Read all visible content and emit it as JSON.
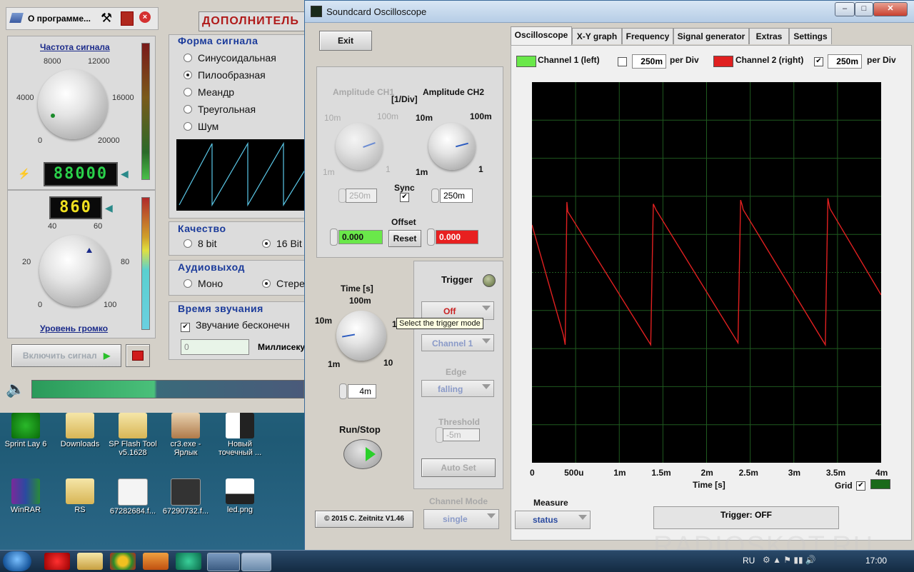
{
  "desktop": {
    "icons": [
      {
        "label": "Sprint Lay 6",
        "line2": ""
      },
      {
        "label": "Downloads",
        "line2": ""
      },
      {
        "label": "SP Flash Tool",
        "line2": "v5.1628"
      },
      {
        "label": "cr3.exe -",
        "line2": "Ярлык"
      },
      {
        "label": "Новый",
        "line2": "точечный ..."
      },
      {
        "label": "WinRAR",
        "line2": ""
      },
      {
        "label": "RS",
        "line2": ""
      },
      {
        "label": "67282684.f...",
        "line2": ""
      },
      {
        "label": "67290732.f...",
        "line2": ""
      },
      {
        "label": "led.png",
        "line2": ""
      }
    ]
  },
  "taskbar": {
    "lang": "RU",
    "clock": "17:00"
  },
  "generator": {
    "about_label": "О программе...",
    "freq_title": "Частота сигнала",
    "freq_scale": [
      "8000",
      "12000",
      "4000",
      "16000",
      "0",
      "20000"
    ],
    "freq_lcd": "88000",
    "level_lcd": "860",
    "level_scale": [
      "40",
      "60",
      "20",
      "80",
      "0",
      "100"
    ],
    "level_title": "Уровень громко",
    "start_label": "Включить сигнал",
    "header_title": "ДОПОЛНИТЕЛЬ",
    "waveform_title": "Форма сигнала",
    "waveforms": [
      "Синусоидальная",
      "Пилообразная",
      "Меандр",
      "Треугольная",
      "Шум"
    ],
    "quality_title": "Качество",
    "quality_opts": [
      "8 bit",
      "16 Bit"
    ],
    "output_title": "Аудиовыход",
    "output_opts": [
      "Моно",
      "Стере"
    ],
    "time_title": "Время звучания",
    "endless_label": "Звучание бесконечн",
    "duration_value": "0",
    "ms_label": "Миллисеку"
  },
  "osc": {
    "title": "Soundcard Oscilloscope",
    "exit_label": "Exit",
    "tabs": [
      "Oscilloscope",
      "X-Y graph",
      "Frequency",
      "Signal generator",
      "Extras",
      "Settings"
    ],
    "ch1_label": "Channel 1 (left)",
    "ch1_div": "250m",
    "per_div": "per Div",
    "ch2_label": "Channel 2 (right)",
    "ch2_div": "250m",
    "amp_ch1": "Amplitude CH1",
    "amp_unit": "[1/Div]",
    "amp_ch2": "Amplitude CH2",
    "amp_scale": [
      "10m",
      "100m",
      "1m",
      "1"
    ],
    "amp_ch1_value": "250m",
    "amp_ch2_value": "250m",
    "sync_label": "Sync",
    "offset_label": "Offset",
    "offset_ch1": "0.000",
    "offset_ch2": "0.000",
    "reset_label": "Reset",
    "time_label": "Time [s]",
    "time_scale": [
      "100m",
      "10m",
      "1",
      "1m",
      "10"
    ],
    "time_value": "4m",
    "runstop_label": "Run/Stop",
    "copyright": "© 2015  C. Zeitnitz V1.46",
    "trigger_title": "Trigger",
    "trigger_mode": "Off",
    "tooltip": "Select the trigger mode",
    "trigger_channel": "Channel 1",
    "edge_label": "Edge",
    "edge_value": "falling",
    "threshold_label": "Threshold",
    "threshold_value": "-5m",
    "autoset_label": "Auto Set",
    "channel_mode_label": "Channel Mode",
    "channel_mode_value": "single",
    "measure_label": "Measure",
    "measure_value": "status",
    "trigger_status": "Trigger: OFF",
    "grid_label": "Grid",
    "xlabel": "Time [s]",
    "watermark": "RADIOSKOT.RU"
  },
  "chart_data": {
    "type": "line",
    "xlabel": "Time [s]",
    "ylabel": "",
    "xticks": [
      "0",
      "500u",
      "1m",
      "1.5m",
      "2m",
      "2.5m",
      "3m",
      "3.5m",
      "4m"
    ],
    "xlim": [
      0,
      0.004
    ],
    "ylim": [
      -1,
      1
    ],
    "grid": true,
    "series": [
      {
        "name": "Channel 2 (right)",
        "color": "#e02020",
        "x": [
          0,
          0.00036,
          0.00038,
          0.0004,
          0.00041,
          0.00136,
          0.00139,
          0.00141,
          0.00142,
          0.00236,
          0.00239,
          0.00241,
          0.00242,
          0.00336,
          0.00339,
          0.00341,
          0.00342,
          0.0004,
          0.0004
        ],
        "y": [
          0.25,
          -0.33,
          -0.38,
          0.37,
          0.32,
          -0.38,
          0.36,
          0.34,
          0.33,
          -0.37,
          0.38,
          0.35,
          0.33,
          -0.38,
          0.39,
          0.34,
          0.33,
          0.32,
          0.32
        ]
      }
    ]
  }
}
